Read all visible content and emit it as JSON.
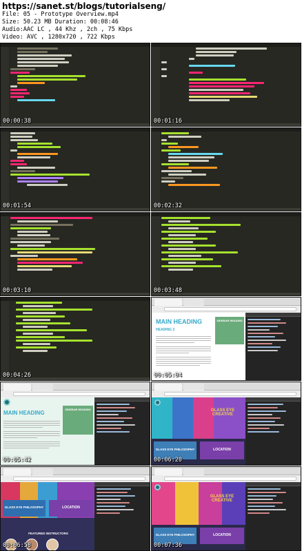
{
  "header": {
    "url": "https://sanet.st/blogs/tutorialseng/",
    "file": "File: 05 - Prototype Overview.mp4",
    "size": "Size: 50.23 MB Duration: 00:08:46",
    "audio": "Audio:AAC LC , 44 Khz , 2ch , 75 Kbps",
    "video": "Video: AVC , 1280x720 , 722 Kbps"
  },
  "thumbnails": [
    {
      "timestamp": "00:00:38",
      "kind": "code-editor"
    },
    {
      "timestamp": "00:01:16",
      "kind": "code-editor"
    },
    {
      "timestamp": "00:01:54",
      "kind": "code-editor"
    },
    {
      "timestamp": "00:02:32",
      "kind": "code-editor"
    },
    {
      "timestamp": "00:03:10",
      "kind": "code-editor"
    },
    {
      "timestamp": "00:03:48",
      "kind": "browser"
    },
    {
      "timestamp": "00:04:26",
      "kind": "code-editor"
    },
    {
      "timestamp": "00:05:04",
      "kind": "browser"
    },
    {
      "timestamp": "00:05:42",
      "kind": "browser"
    },
    {
      "timestamp": "00:06:20",
      "kind": "browser"
    },
    {
      "timestamp": "00:06:58",
      "kind": "browser"
    },
    {
      "timestamp": "00:07:36",
      "kind": "browser"
    }
  ],
  "prototype": {
    "main_heading": "MAIN HEADING",
    "heading_2": "HEADING 2",
    "sidebar_heading": "SIDEBAR HEADING",
    "hero_title": "GLASS EYE CREATIVE",
    "philosophy": "GLASS EYE PHILOSOPHY",
    "location": "LOCATION",
    "featured": "FEATURED INSTRUCTORS"
  },
  "colors": {
    "editor_bg": "#272822",
    "accent_blue": "#36a9c9",
    "sidebar_green": "#6aab7b",
    "tile_blue": "#3f7fb8",
    "tile_purple": "#7a3fa8"
  }
}
